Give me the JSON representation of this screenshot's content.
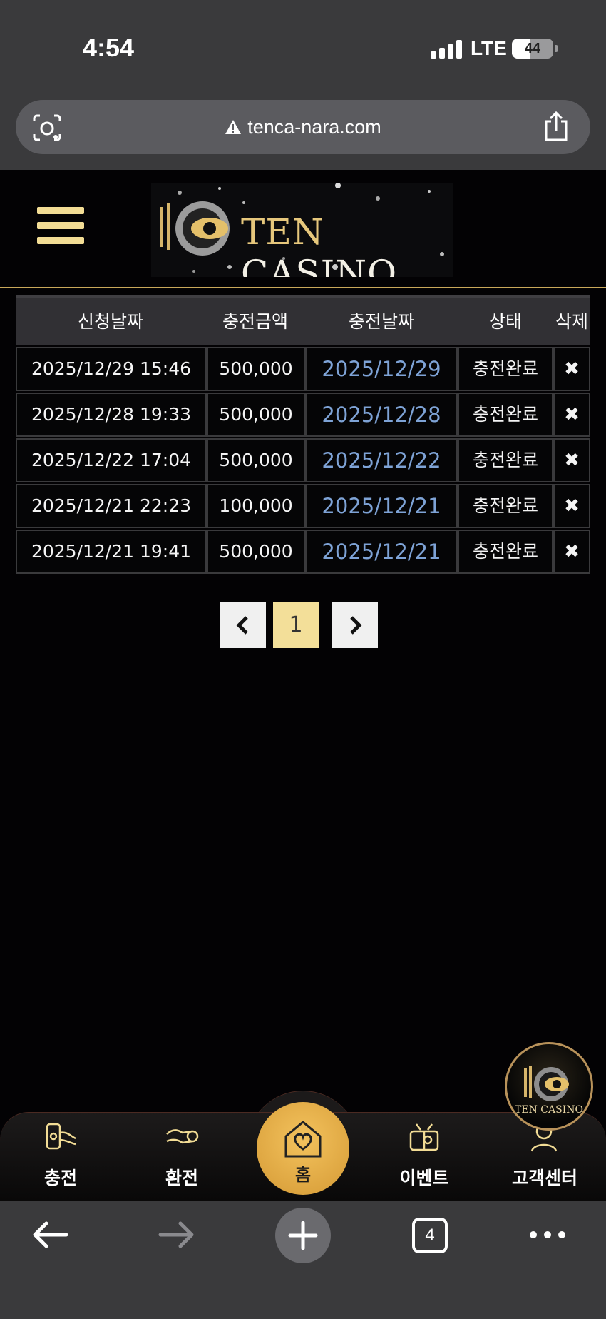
{
  "status_bar": {
    "time": "4:54",
    "network": "LTE",
    "battery": "44",
    "battery_level_percent": 44
  },
  "browser": {
    "url": "tenca-nara.com",
    "tab_count": "4"
  },
  "header": {
    "logo_word1": "TEN",
    "logo_word2": "CASINO"
  },
  "table": {
    "columns": [
      "신청날짜",
      "충전금액",
      "충전날짜",
      "상태",
      "삭제"
    ],
    "rows": [
      {
        "request_date": "2025/12/29 15:46",
        "amount": "500,000",
        "charge_date": "2025/12/29",
        "status": "충전완료",
        "delete": "✖"
      },
      {
        "request_date": "2025/12/28 19:33",
        "amount": "500,000",
        "charge_date": "2025/12/28",
        "status": "충전완료",
        "delete": "✖"
      },
      {
        "request_date": "2025/12/22 17:04",
        "amount": "500,000",
        "charge_date": "2025/12/22",
        "status": "충전완료",
        "delete": "✖"
      },
      {
        "request_date": "2025/12/21 22:23",
        "amount": "100,000",
        "charge_date": "2025/12/21",
        "status": "충전완료",
        "delete": "✖"
      },
      {
        "request_date": "2025/12/21 19:41",
        "amount": "500,000",
        "charge_date": "2025/12/21",
        "status": "충전완료",
        "delete": "✖"
      }
    ]
  },
  "pagination": {
    "current_page": "1"
  },
  "floating_logo": {
    "text": "TEN CASINO"
  },
  "bottom_nav": {
    "items": [
      {
        "label": "충전",
        "icon": "charge-icon"
      },
      {
        "label": "환전",
        "icon": "exchange-icon"
      },
      {
        "label": "홈",
        "icon": "home-heart-icon"
      },
      {
        "label": "이벤트",
        "icon": "gift-icon"
      },
      {
        "label": "고객센터",
        "icon": "support-icon"
      }
    ]
  },
  "colors": {
    "gold": "#f2dc95",
    "link_blue": "#7ea3d6",
    "home_orange": "#e0a840",
    "background": "#030204"
  }
}
